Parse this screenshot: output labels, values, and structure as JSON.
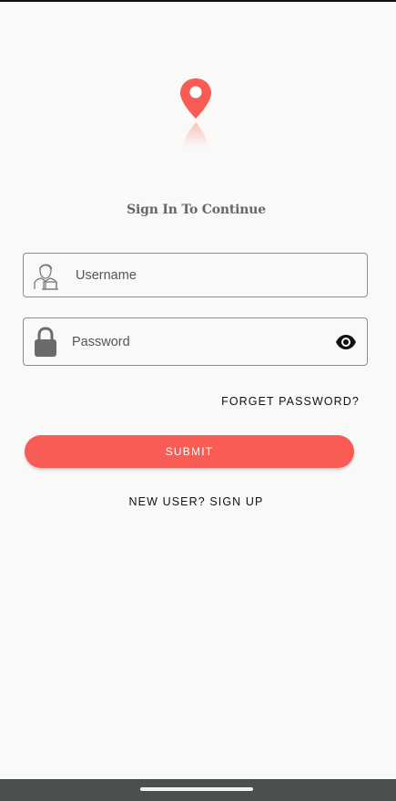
{
  "colors": {
    "accent": "#f95b55",
    "background": "#f9faf8",
    "navbar": "#4b4f4d"
  },
  "logo": {
    "icon": "location-pin-icon"
  },
  "heading": "Sign In To Continue",
  "username": {
    "placeholder": "Username",
    "icon": "user-laptop-icon"
  },
  "password": {
    "placeholder": "Password",
    "icon": "lock-icon",
    "toggle_icon": "eye-icon"
  },
  "forget_password": "FORGET PASSWORD?",
  "submit": "SUBMIT",
  "signup": "NEW USER? SIGN UP"
}
